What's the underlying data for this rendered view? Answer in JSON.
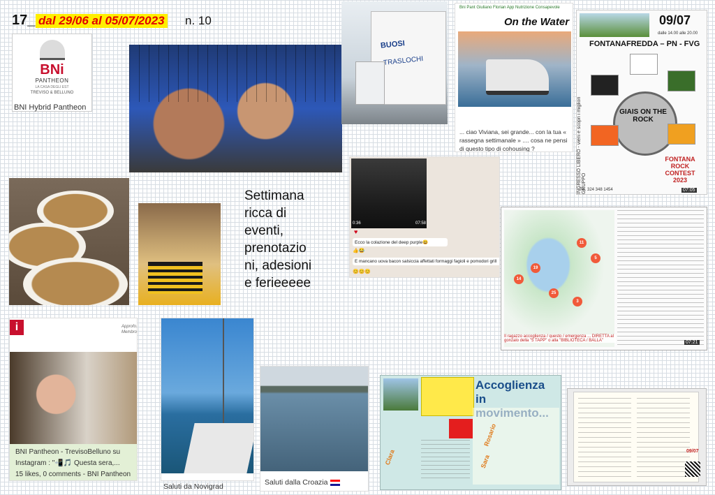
{
  "header": {
    "issue_num": "17_",
    "date_range": "dal 29/06 al 05/07/2023",
    "issue_label": "n. 10"
  },
  "bni_logo": {
    "letters": "BNi",
    "line1": "PANTHEON",
    "line2": "LA CASA DEGLI EST",
    "line3": "TREVISO & BELLUNO",
    "caption": "BNI Hybrid Pantheon"
  },
  "truck": {
    "logo": "BUOSI",
    "subtitle": "TRASLOCHI"
  },
  "water_post": {
    "tag": "Bni Pant Giuliano Florian App Nutrizione Consapevole",
    "title": "On the Water",
    "comment": "... ciao Viviana, sei grande... con la tua « rassegna settimanale » .... cosa ne pensi di questo tipo di cohousing ?"
  },
  "poster": {
    "date": "09/07",
    "time": "dalle 14.00 alle 20.00",
    "town": "FONTANAFREDDA – PN - FVG",
    "side_text": "INGRESSO LIBERO - vieni e scopri i migliori GRUPPO",
    "band": "GIAIS ON THE ROCK",
    "contest": "FONTANA ROCK CONTEST 2023",
    "tel": "Tel. 324 348 1454",
    "timecode": "07:05"
  },
  "center_text": {
    "line1": "Settimana",
    "line2": "ricca di",
    "line3": "eventi,",
    "line4": "prenotazio",
    "line5": "ni, adesioni",
    "line6": "e ferieeeee"
  },
  "whatsapp": {
    "duration": "0:36",
    "time1": "07:58",
    "msg1": "Ecco la colazione del deep purple😃",
    "likes": "👍😂",
    "msg2": "E mancano uova bacon salsiccia affettati formaggi fagioli e pomodori grill",
    "msg2_emoji": "😊😊😊"
  },
  "map": {
    "note": "Il ragazzo accoglienza / questo / emergenza ... DIRETTA al gonzalo della \"5 TAPP\" o alla \"BIBLIOTECA / BALLA\"",
    "timecode": "07:21",
    "pins": [
      "19",
      "14",
      "25",
      "11",
      "5",
      "3"
    ]
  },
  "instagram": {
    "logo": "i",
    "app_text": "Approfo... Membro",
    "caption1": "BNI Pantheon - TrevisoBelluno su",
    "caption2": "Instagram : \"📲🎵 Questa sera,...",
    "caption3": "15 likes, 0 comments - BNI Pantheon -"
  },
  "boat": {
    "caption": "Saluti da Novigrad"
  },
  "sea": {
    "caption": "Saluti dalla Croazia"
  },
  "accoglienza": {
    "title1": "Accoglienza",
    "title2": "in movimento...",
    "names": [
      "Rosario",
      "Sara",
      "Clara"
    ]
  },
  "doc": {
    "date": "09/07"
  }
}
